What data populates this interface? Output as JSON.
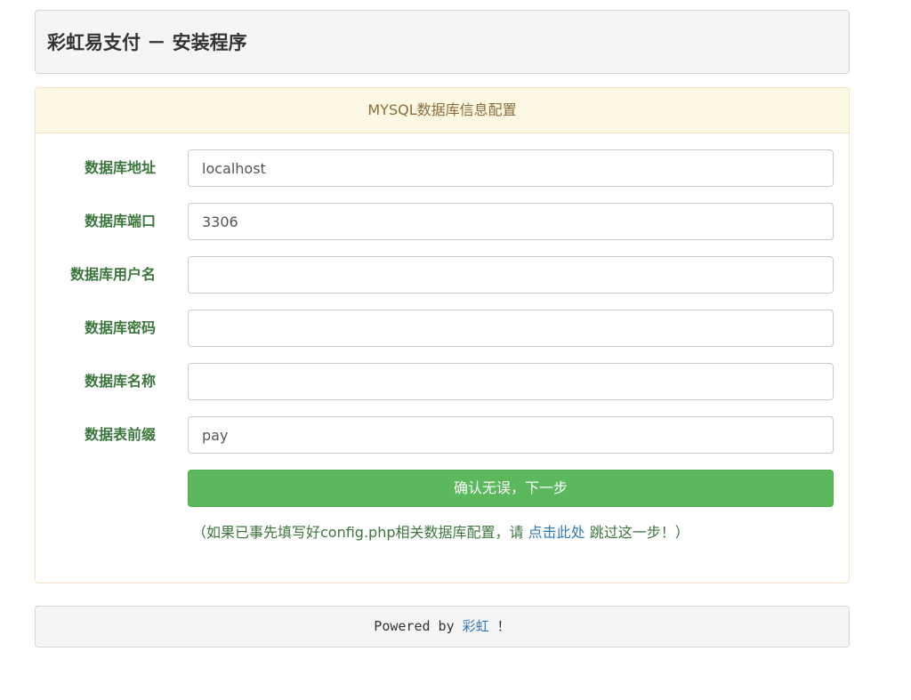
{
  "header": {
    "title": "彩虹易支付 － 安装程序"
  },
  "form": {
    "section_title": "MYSQL数据库信息配置",
    "fields": [
      {
        "label": "数据库地址",
        "value": "localhost",
        "placeholder": ""
      },
      {
        "label": "数据库端口",
        "value": "3306",
        "placeholder": ""
      },
      {
        "label": "数据库用户名",
        "value": "",
        "placeholder": ""
      },
      {
        "label": "数据库密码",
        "value": "",
        "placeholder": ""
      },
      {
        "label": "数据库名称",
        "value": "",
        "placeholder": ""
      },
      {
        "label": "数据表前缀",
        "value": "pay",
        "placeholder": ""
      }
    ],
    "submit_label": "确认无误，下一步",
    "hint_prefix": "（如果已事先填写好config.php相关数据库配置，请 ",
    "hint_link": "点击此处",
    "hint_suffix": " 跳过这一步！）"
  },
  "footer": {
    "prefix": "Powered by ",
    "link": "彩虹",
    "suffix": " ！"
  }
}
